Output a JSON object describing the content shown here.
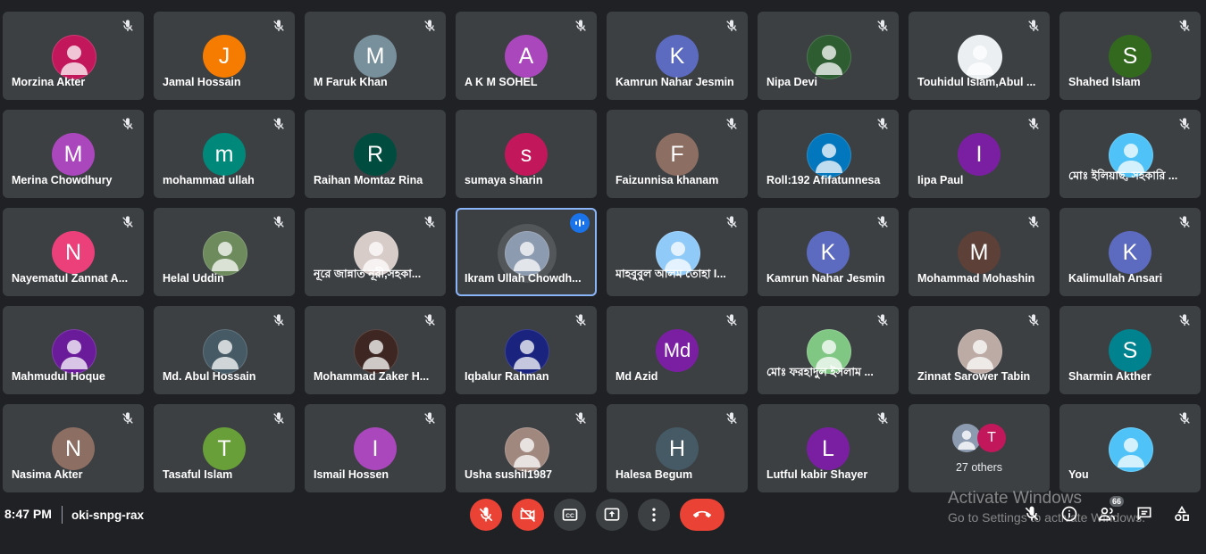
{
  "participants": [
    {
      "name": "Morzina Akter",
      "avatar_type": "photo",
      "color": "#c2185b",
      "muted": true
    },
    {
      "name": "Jamal Hossain",
      "avatar_type": "letter",
      "letter": "J",
      "color": "#f57c00",
      "muted": true
    },
    {
      "name": "M Faruk Khan",
      "avatar_type": "letter",
      "letter": "M",
      "color": "#78909c",
      "muted": true
    },
    {
      "name": "A K M SOHEL",
      "avatar_type": "letter",
      "letter": "A",
      "color": "#ab47bc",
      "muted": true
    },
    {
      "name": "Kamrun Nahar Jesmin",
      "avatar_type": "letter",
      "letter": "K",
      "color": "#5c6bc0",
      "muted": true
    },
    {
      "name": "Nipa Devi",
      "avatar_type": "photo",
      "color": "#2e5d32",
      "muted": true
    },
    {
      "name": "Touhidul Islam,Abul ...",
      "avatar_type": "photo",
      "color": "#eceff1",
      "muted": true
    },
    {
      "name": "Shahed Islam",
      "avatar_type": "letter",
      "letter": "S",
      "color": "#33691e",
      "muted": true
    },
    {
      "name": "Merina Chowdhury",
      "avatar_type": "letter",
      "letter": "M",
      "color": "#ab47bc",
      "muted": true
    },
    {
      "name": "mohammad ullah",
      "avatar_type": "letter",
      "letter": "m",
      "color": "#00897b",
      "muted": true
    },
    {
      "name": "Raihan Momtaz Rina",
      "avatar_type": "letter",
      "letter": "R",
      "color": "#004d40",
      "muted": false
    },
    {
      "name": "sumaya sharin",
      "avatar_type": "letter",
      "letter": "s",
      "color": "#c2185b",
      "muted": false
    },
    {
      "name": "Faizunnisa khanam",
      "avatar_type": "letter",
      "letter": "F",
      "color": "#8d6e63",
      "muted": true
    },
    {
      "name": "Roll:192 Afifatunnesa",
      "avatar_type": "photo",
      "color": "#0277bd",
      "muted": true
    },
    {
      "name": "Iipa Paul",
      "avatar_type": "letter",
      "letter": "I",
      "color": "#7b1fa2",
      "muted": true
    },
    {
      "name": "মোঃ ইলিয়াছ, সহকারি ...",
      "avatar_type": "photo",
      "color": "#4fc3f7",
      "muted": true
    },
    {
      "name": "Nayematul Zannat A...",
      "avatar_type": "letter",
      "letter": "N",
      "color": "#ec407a",
      "muted": true
    },
    {
      "name": "Helal Uddin",
      "avatar_type": "photo",
      "color": "#6d8b5c",
      "muted": true
    },
    {
      "name": "নূরে জান্নাত নূরী,সহকা...",
      "avatar_type": "photo",
      "color": "#d7ccc8",
      "muted": true
    },
    {
      "name": "Ikram Ullah Chowdh...",
      "avatar_type": "photo",
      "color": "#8d9bb0",
      "muted": false,
      "speaking": true
    },
    {
      "name": "মাহবুবুল আলম তোহা I...",
      "avatar_type": "photo",
      "color": "#90caf9",
      "muted": true
    },
    {
      "name": "Kamrun Nahar Jesmin",
      "avatar_type": "letter",
      "letter": "K",
      "color": "#5c6bc0",
      "muted": true
    },
    {
      "name": "Mohammad Mohashin",
      "avatar_type": "letter",
      "letter": "M",
      "color": "#5d4037",
      "muted": true
    },
    {
      "name": "Kalimullah Ansari",
      "avatar_type": "letter",
      "letter": "K",
      "color": "#5c6bc0",
      "muted": true
    },
    {
      "name": "Mahmudul Hoque",
      "avatar_type": "photo",
      "color": "#6a1b9a",
      "muted": false
    },
    {
      "name": "Md. Abul Hossain",
      "avatar_type": "photo",
      "color": "#455a64",
      "muted": true
    },
    {
      "name": "Mohammad Zaker H...",
      "avatar_type": "photo",
      "color": "#3e2723",
      "muted": true
    },
    {
      "name": "Iqbalur Rahman",
      "avatar_type": "photo",
      "color": "#1a237e",
      "muted": true
    },
    {
      "name": "Md Azid",
      "avatar_type": "letter",
      "letter": "Md",
      "color": "#7b1fa2",
      "muted": true
    },
    {
      "name": "মোঃ ফরহাদুল ইসলাম ...",
      "avatar_type": "photo",
      "color": "#81c784",
      "muted": true
    },
    {
      "name": "Zinnat Sarower Tabin",
      "avatar_type": "photo",
      "color": "#bcaaa4",
      "muted": true
    },
    {
      "name": "Sharmin Akther",
      "avatar_type": "letter",
      "letter": "S",
      "color": "#00838f",
      "muted": true
    },
    {
      "name": "Nasima Akter",
      "avatar_type": "letter",
      "letter": "N",
      "color": "#8d6e63",
      "muted": true
    },
    {
      "name": "Tasaful Islam",
      "avatar_type": "letter",
      "letter": "T",
      "color": "#689f38",
      "muted": true
    },
    {
      "name": "Ismail Hossen",
      "avatar_type": "letter",
      "letter": "I",
      "color": "#ab47bc",
      "muted": true
    },
    {
      "name": "Usha sushil1987",
      "avatar_type": "photo",
      "color": "#a1887f",
      "muted": true
    },
    {
      "name": "Halesa Begum",
      "avatar_type": "letter",
      "letter": "H",
      "color": "#455a64",
      "muted": true
    },
    {
      "name": "Lutful kabir Shayer",
      "avatar_type": "letter",
      "letter": "L",
      "color": "#7b1fa2",
      "muted": true
    },
    {
      "others": true,
      "label": "27 others",
      "letter": "T",
      "color": "#c2185b"
    },
    {
      "name": "You",
      "avatar_type": "photo",
      "color": "#4fc3f7",
      "muted": true
    }
  ],
  "bottom_bar": {
    "time": "8:47 PM",
    "meeting_code": "oki-snpg-rax",
    "people_count": "66"
  },
  "watermark": {
    "line1": "Activate Windows",
    "line2": "Go to Settings to activate Windows."
  },
  "colors": {
    "background": "#202124",
    "tile": "#3c4043",
    "end_call": "#ea4335",
    "speaking_outline": "#8ab4f8"
  }
}
